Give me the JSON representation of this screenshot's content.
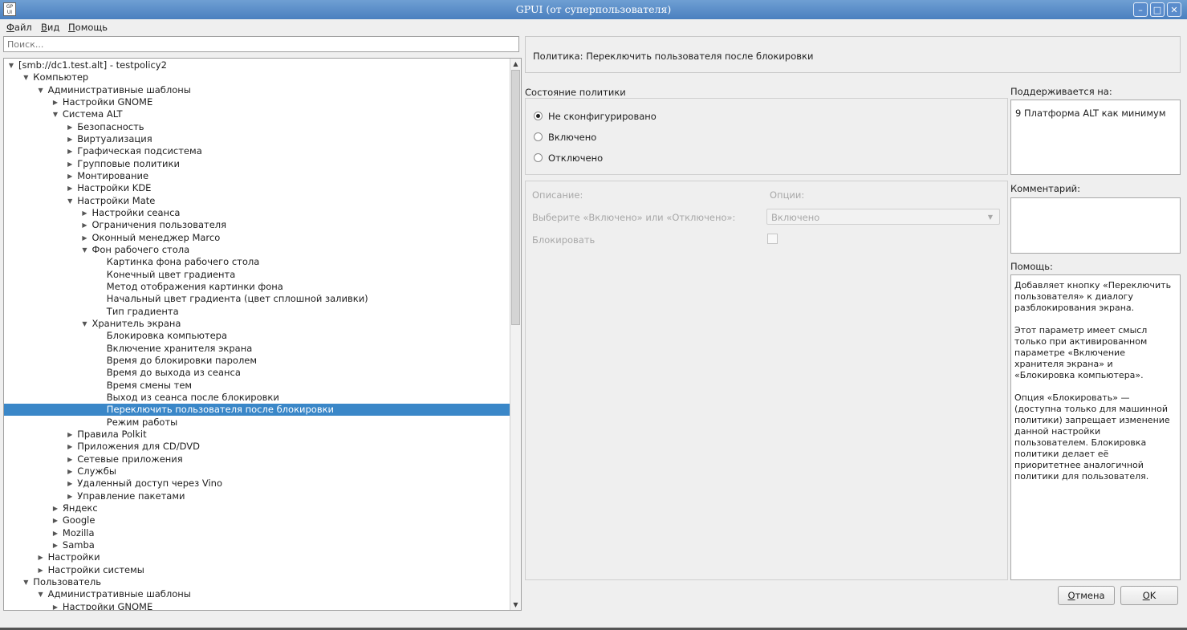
{
  "window": {
    "app_icon": "GP\nUI",
    "title": "GPUI (от суперпользователя)",
    "buttons": [
      "minimize",
      "maximize",
      "close"
    ]
  },
  "menu": [
    {
      "label": "Файл",
      "mnemonic": "Ф",
      "rest": "айл"
    },
    {
      "label": "Вид",
      "mnemonic": "В",
      "rest": "ид"
    },
    {
      "label": "Помощь",
      "mnemonic": "П",
      "rest": "омощь"
    }
  ],
  "search": {
    "placeholder": "Поиск..."
  },
  "tree": [
    {
      "label": "[smb://dc1.test.alt] - testpolicy2",
      "level": 0,
      "arrow": "open"
    },
    {
      "label": "Компьютер",
      "level": 1,
      "arrow": "open"
    },
    {
      "label": "Административные шаблоны",
      "level": 2,
      "arrow": "open"
    },
    {
      "label": "Настройки GNOME",
      "level": 3,
      "arrow": "closed"
    },
    {
      "label": "Система ALT",
      "level": 3,
      "arrow": "open"
    },
    {
      "label": "Безопасность",
      "level": 4,
      "arrow": "closed"
    },
    {
      "label": "Виртуализация",
      "level": 4,
      "arrow": "closed"
    },
    {
      "label": "Графическая подсистема",
      "level": 4,
      "arrow": "closed"
    },
    {
      "label": "Групповые политики",
      "level": 4,
      "arrow": "closed"
    },
    {
      "label": "Монтирование",
      "level": 4,
      "arrow": "closed"
    },
    {
      "label": "Настройки KDE",
      "level": 4,
      "arrow": "closed"
    },
    {
      "label": "Настройки Mate",
      "level": 4,
      "arrow": "open"
    },
    {
      "label": "Настройки сеанса",
      "level": 5,
      "arrow": "closed"
    },
    {
      "label": "Ограничения пользователя",
      "level": 5,
      "arrow": "closed"
    },
    {
      "label": "Оконный менеджер Marco",
      "level": 5,
      "arrow": "closed"
    },
    {
      "label": "Фон рабочего стола",
      "level": 5,
      "arrow": "open"
    },
    {
      "label": "Картинка фона рабочего стола",
      "level": 6,
      "arrow": ""
    },
    {
      "label": "Конечный цвет градиента",
      "level": 6,
      "arrow": ""
    },
    {
      "label": "Метод отображения картинки фона",
      "level": 6,
      "arrow": ""
    },
    {
      "label": "Начальный цвет градиента (цвет сплошной заливки)",
      "level": 6,
      "arrow": ""
    },
    {
      "label": "Тип градиента",
      "level": 6,
      "arrow": ""
    },
    {
      "label": "Хранитель экрана",
      "level": 5,
      "arrow": "open"
    },
    {
      "label": "Блокировка компьютера",
      "level": 6,
      "arrow": ""
    },
    {
      "label": "Включение хранителя экрана",
      "level": 6,
      "arrow": ""
    },
    {
      "label": "Время до блокировки паролем",
      "level": 6,
      "arrow": ""
    },
    {
      "label": "Время до выхода из сеанса",
      "level": 6,
      "arrow": ""
    },
    {
      "label": "Время смены тем",
      "level": 6,
      "arrow": ""
    },
    {
      "label": "Выход из сеанса после блокировки",
      "level": 6,
      "arrow": ""
    },
    {
      "label": "Переключить пользователя после блокировки",
      "level": 6,
      "arrow": "",
      "selected": true
    },
    {
      "label": "Режим работы",
      "level": 6,
      "arrow": ""
    },
    {
      "label": "Правила Polkit",
      "level": 4,
      "arrow": "closed"
    },
    {
      "label": "Приложения для CD/DVD",
      "level": 4,
      "arrow": "closed"
    },
    {
      "label": "Сетевые приложения",
      "level": 4,
      "arrow": "closed"
    },
    {
      "label": "Службы",
      "level": 4,
      "arrow": "closed"
    },
    {
      "label": "Удаленный доступ через Vino",
      "level": 4,
      "arrow": "closed"
    },
    {
      "label": "Управление пакетами",
      "level": 4,
      "arrow": "closed"
    },
    {
      "label": "Яндекс",
      "level": 3,
      "arrow": "closed"
    },
    {
      "label": "Google",
      "level": 3,
      "arrow": "closed"
    },
    {
      "label": "Mozilla",
      "level": 3,
      "arrow": "closed"
    },
    {
      "label": "Samba",
      "level": 3,
      "arrow": "closed"
    },
    {
      "label": "Настройки",
      "level": 2,
      "arrow": "closed"
    },
    {
      "label": "Настройки системы",
      "level": 2,
      "arrow": "closed"
    },
    {
      "label": "Пользователь",
      "level": 1,
      "arrow": "open"
    },
    {
      "label": "Административные шаблоны",
      "level": 2,
      "arrow": "open"
    },
    {
      "label": "Настройки GNOME",
      "level": 3,
      "arrow": "closed"
    }
  ],
  "policy": {
    "title": "Политика: Переключить пользователя после блокировки",
    "state_label": "Состояние политики",
    "states": [
      {
        "label": "Не сконфигурировано",
        "checked": true
      },
      {
        "label": "Включено",
        "checked": false
      },
      {
        "label": "Отключено",
        "checked": false
      }
    ],
    "description_label": "Описание:",
    "options_label": "Опции:",
    "choose_label": "Выберите «Включено» или «Отключено»:",
    "choose_value": "Включено",
    "lock_label": "Блокировать",
    "lock_checked": false
  },
  "supported": {
    "label": "Поддерживается на:",
    "value": "9 Платформа ALT как минимум"
  },
  "comment": {
    "label": "Комментарий:",
    "value": ""
  },
  "help": {
    "label": "Помощь:",
    "text": "Добавляет кнопку «Переключить пользователя» к диалогу разблокирования экрана.\n\nЭтот параметр имеет смысл только при активированном параметре «Включение хранителя экрана» и «Блокировка компьютера».\n\nОпция «Блокировать» — (доступна только для машинной политики) запрещает изменение данной настройки пользователем. Блокировка политики делает её приоритетнее аналогичной политики для пользователя."
  },
  "buttons": {
    "cancel": {
      "label": "Отмена",
      "mnemonic": "О",
      "rest": "тмена"
    },
    "ok": {
      "label": "OK",
      "mnemonic": "O",
      "rest": "K"
    }
  },
  "colors": {
    "selection": "#3a87c8",
    "titlebar": "#4a7fbf"
  }
}
